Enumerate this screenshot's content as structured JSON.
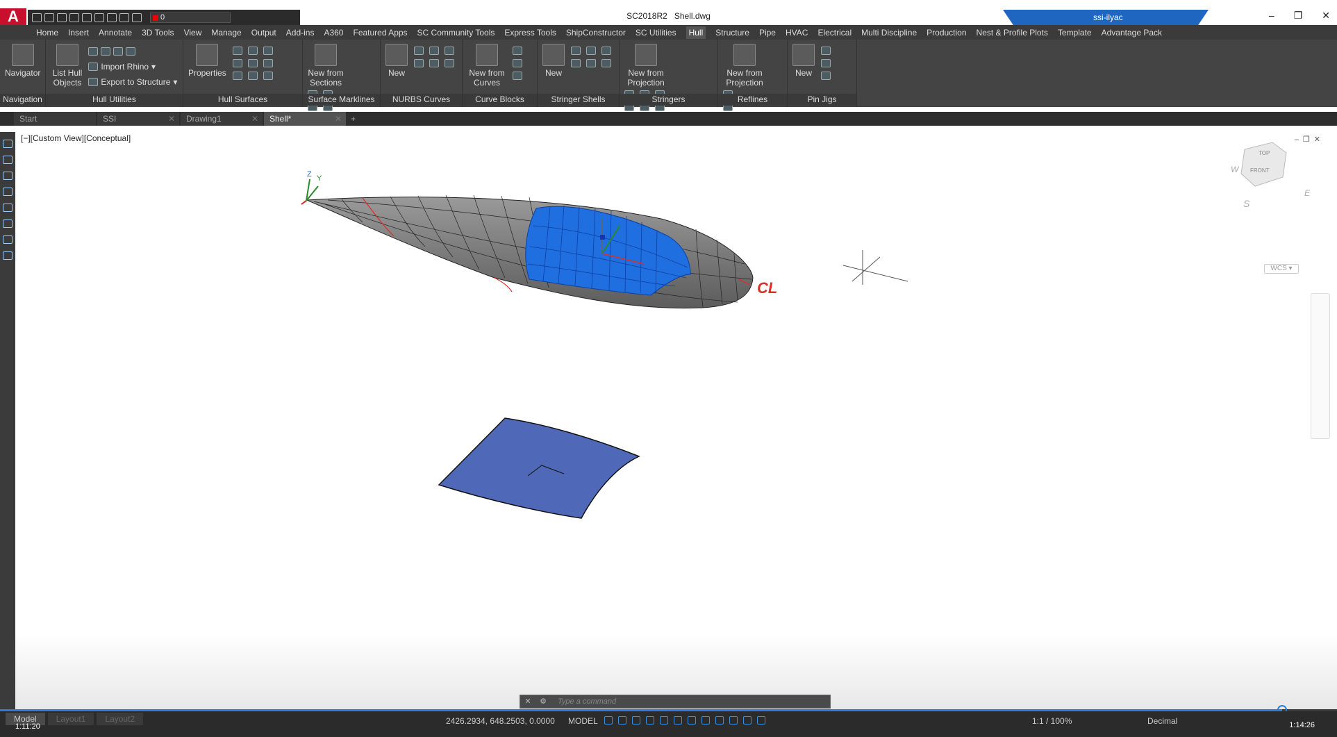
{
  "title": {
    "app_version": "SC2018R2",
    "file": "Shell.dwg",
    "user": "ssi-ilyac",
    "layer": "0"
  },
  "menu": [
    "Home",
    "Insert",
    "Annotate",
    "3D Tools",
    "View",
    "Manage",
    "Output",
    "Add-ins",
    "A360",
    "Featured Apps",
    "SC Community Tools",
    "Express Tools",
    "ShipConstructor",
    "SC Utilities",
    "Hull",
    "Structure",
    "Pipe",
    "HVAC",
    "Electrical",
    "Multi Discipline",
    "Production",
    "Nest & Profile Plots",
    "Template",
    "Advantage Pack"
  ],
  "active_menu": "Hull",
  "ribbon": {
    "navigation": {
      "label": "Navigation",
      "btn": "Navigator"
    },
    "hull_utilities": {
      "label": "Hull Utilities",
      "list": "List Hull Objects",
      "import": "Import Rhino",
      "export": "Export to Structure"
    },
    "hull_surfaces": {
      "label": "Hull Surfaces",
      "props": "Properties"
    },
    "surface_marklines": {
      "label": "Surface Marklines",
      "btn": "New from Sections"
    },
    "nurbs": {
      "label": "NURBS Curves",
      "btn": "New"
    },
    "curve_blocks": {
      "label": "Curve Blocks",
      "btn": "New from Curves"
    },
    "stringer_shells": {
      "label": "Stringer Shells",
      "btn": "New"
    },
    "stringers": {
      "label": "Stringers",
      "btn": "New from Projection"
    },
    "reflines": {
      "label": "Reflines",
      "btn": "New from Projection"
    },
    "pin_jigs": {
      "label": "Pin Jigs",
      "btn": "New"
    }
  },
  "file_tabs": [
    "Start",
    "SSI",
    "Drawing1",
    "Shell*"
  ],
  "active_file_tab": "Shell*",
  "viewport": {
    "label": "[−][Custom View][Conceptual]",
    "cl_label": "CL",
    "axis_z": "Z",
    "axis_y": "Y",
    "viewcube_top": "TOP",
    "viewcube_front": "FRONT",
    "compass_w": "W",
    "compass_e": "E",
    "compass_s": "S",
    "wcs": "WCS"
  },
  "command": {
    "placeholder": "Type a command"
  },
  "status": {
    "layout_tabs": [
      "Model",
      "Layout1",
      "Layout2"
    ],
    "coords": "2426.2934, 648.2503, 0.0000",
    "model": "MODEL",
    "scale": "1:1 / 100%",
    "units": "Decimal"
  },
  "video": {
    "elapsed": "1:11:20",
    "total": "1:14:26",
    "progress": 0.959
  },
  "colors": {
    "accent": "#2a7fd4",
    "selection": "#1f6fe0",
    "hull": "#8a8a8a",
    "plate": "#4f69b8",
    "cl": "#d9302a"
  }
}
